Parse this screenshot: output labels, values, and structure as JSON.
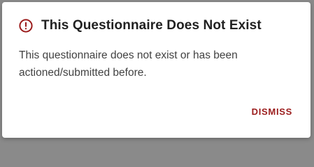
{
  "dialog": {
    "icon": "alert-circle-icon",
    "title": "This Questionnaire Does Not Exist",
    "message": "This questionnaire does not exist or has been actioned/submitted before.",
    "dismiss_label": "DISMISS"
  },
  "colors": {
    "accent": "#9b1c1c",
    "title_text": "#212121",
    "body_text": "#424242",
    "backdrop": "#8a8a8a",
    "dialog_bg": "#ffffff"
  }
}
